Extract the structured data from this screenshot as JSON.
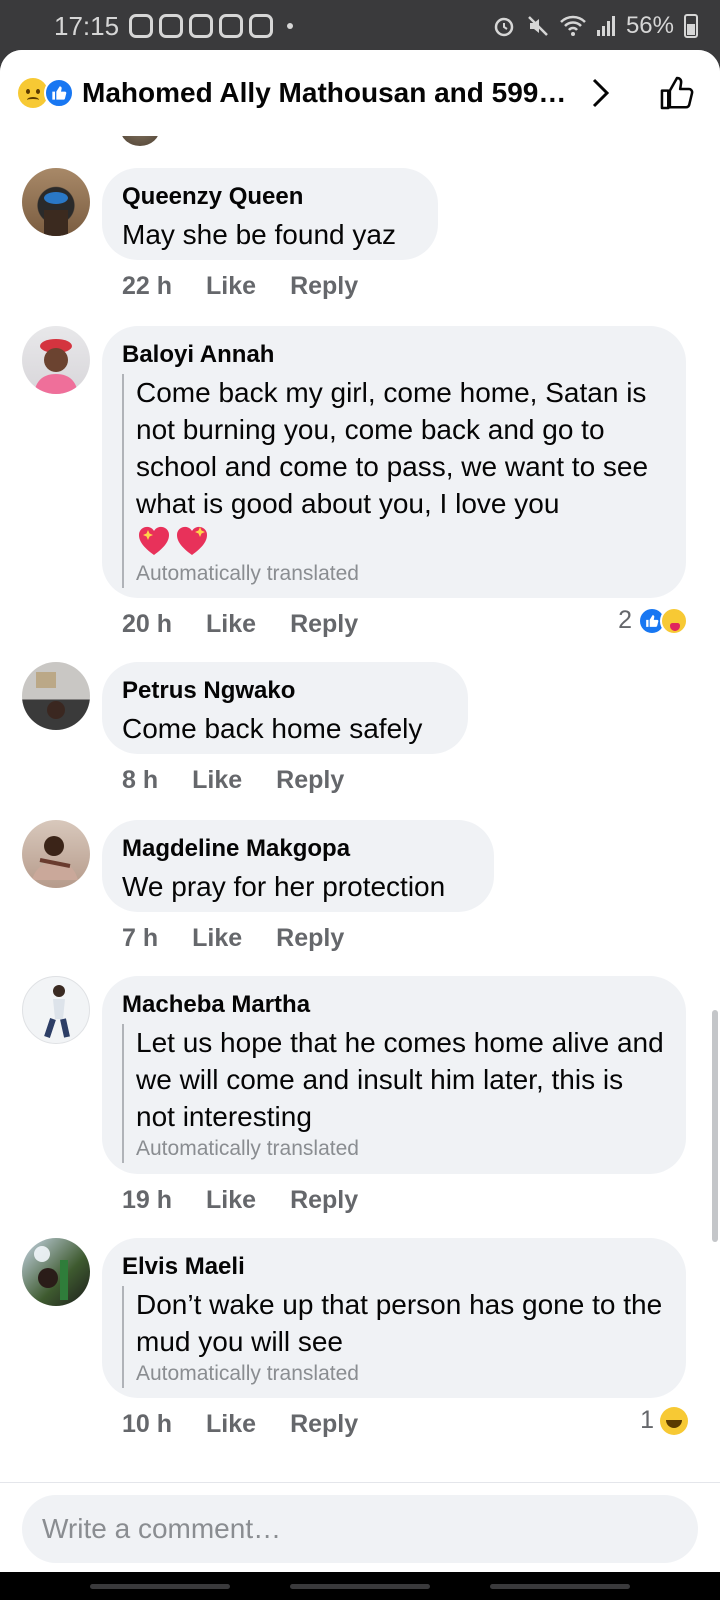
{
  "status_bar": {
    "time": "17:15",
    "battery": "56%"
  },
  "header": {
    "title": "Mahomed Ally Mathousan and 599…",
    "reactions": [
      "sad",
      "like"
    ]
  },
  "comments": [
    {
      "author": "Queenzy Queen",
      "text": "May she be found yaz",
      "time": "22 h",
      "like_label": "Like",
      "reply_label": "Reply",
      "translated": false
    },
    {
      "author": "Baloyi Annah",
      "text": "Come back my girl, come home, Satan is not burning you, come back and go to school and come to pass, we want to see what is good about you, I love you",
      "emoji": [
        "sparkling-heart",
        "sparkling-heart"
      ],
      "translated_label": "Automatically translated",
      "time": "20 h",
      "like_label": "Like",
      "reply_label": "Reply",
      "reaction_count": "2",
      "reactions": [
        "like",
        "care"
      ]
    },
    {
      "author": "Petrus Ngwako",
      "text": "Come back home safely",
      "time": "8 h",
      "like_label": "Like",
      "reply_label": "Reply",
      "translated": false
    },
    {
      "author": "Magdeline Makgopa",
      "text": "We pray for her protection",
      "time": "7 h",
      "like_label": "Like",
      "reply_label": "Reply",
      "translated": false
    },
    {
      "author": "Macheba Martha",
      "text": "Let us hope that he comes home alive and we will come and insult him later, this is not interesting",
      "translated_label": "Automatically translated",
      "time": "19 h",
      "like_label": "Like",
      "reply_label": "Reply"
    },
    {
      "author": "Elvis Maeli",
      "text": "Don’t wake up that person has gone to the mud you will see",
      "translated_label": "Automatically translated",
      "time": "10 h",
      "like_label": "Like",
      "reply_label": "Reply",
      "reaction_count": "1",
      "reactions": [
        "haha"
      ]
    }
  ],
  "composer": {
    "placeholder": "Write a comment…"
  }
}
